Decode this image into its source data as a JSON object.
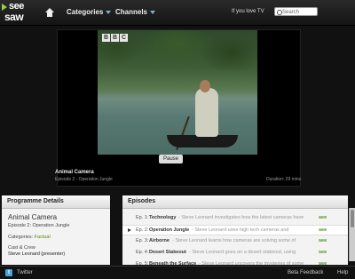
{
  "header": {
    "logo_top": "see",
    "logo_bottom": "saw",
    "nav": [
      "Categories",
      "Channels"
    ],
    "tagline": "If you love TV",
    "search_placeholder": "Search"
  },
  "player": {
    "channel_logo": [
      "B",
      "B",
      "C"
    ],
    "pause_label": "Pause",
    "title": "Animal Camera",
    "subtitle": "Episode 2 - Operation Jungle",
    "duration": "Duration: 29 mins"
  },
  "details": {
    "header": "Programme Details",
    "title": "Animal Camera",
    "episode": "Episode 2: Operation Jungle",
    "category_label": "Categories:",
    "category": "Factual",
    "cast_label": "Cast & Crew",
    "cast_name": "Steve Leonard (presenter)"
  },
  "episodes": {
    "header": "Episodes",
    "items": [
      {
        "num": "Ep. 1:",
        "title": "Technology",
        "desc": "- Steve Leonard investigates how the latest cameras have",
        "see": "see",
        "selected": false
      },
      {
        "num": "Ep. 2:",
        "title": "Operation Jungle",
        "desc": "- Steve Leonard uses high tech cameras and",
        "see": "see",
        "selected": true
      },
      {
        "num": "Ep. 3:",
        "title": "Airborne",
        "desc": "- Steve Leonard learns how cameras are solving some of",
        "see": "see",
        "selected": false
      },
      {
        "num": "Ep. 4:",
        "title": "Desert Stakeout",
        "desc": "- Steve Leonard goes on a desert stakeout, using",
        "see": "see",
        "selected": false
      },
      {
        "num": "Ep. 5:",
        "title": "Beneath the Surface",
        "desc": "- Steve Leonard uncovers the mysteries of some",
        "see": "see",
        "selected": false
      }
    ]
  },
  "footer": {
    "twitter_icon_letter": "t",
    "twitter": "Twitter",
    "feedback": "Beta Feedback",
    "help": "Help"
  }
}
